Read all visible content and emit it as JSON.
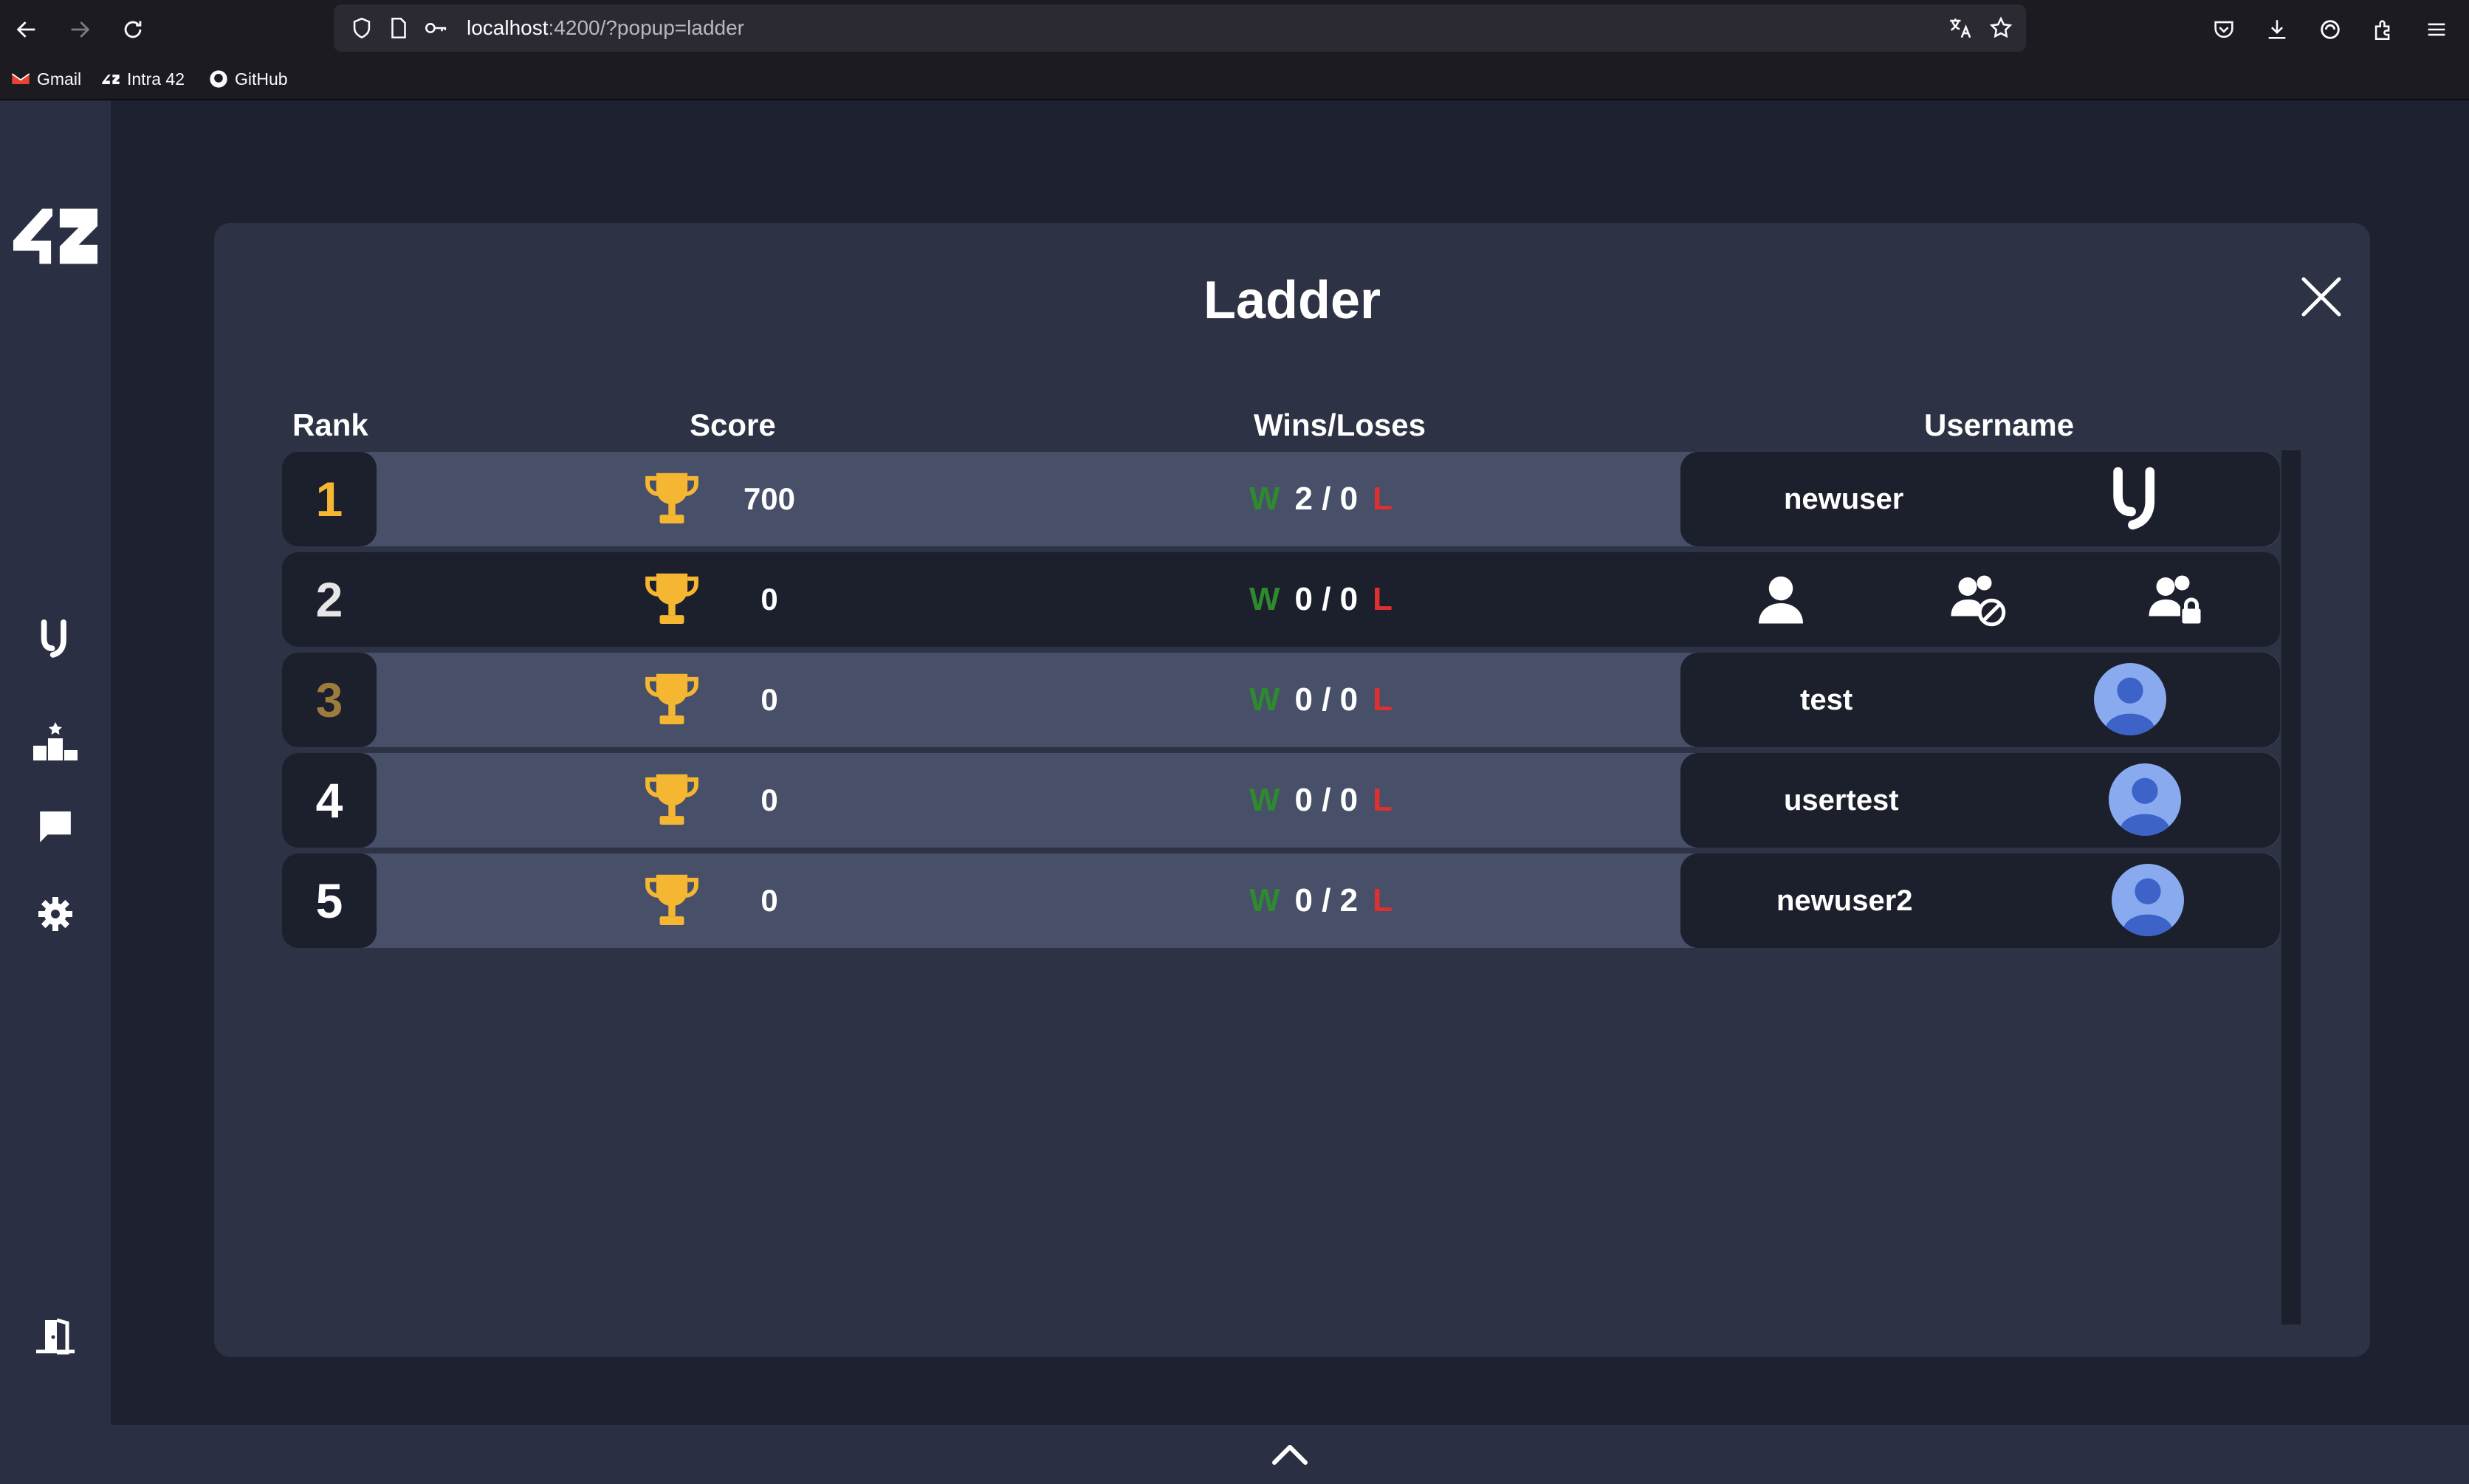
{
  "browser": {
    "url_host": "localhost",
    "url_rest": ":4200/?popup=ladder",
    "bookmarks": [
      {
        "label": "Gmail",
        "icon": "gmail-icon"
      },
      {
        "label": "Intra 42",
        "icon": "intra-42-icon"
      },
      {
        "label": "GitHub",
        "icon": "github-icon"
      }
    ]
  },
  "sidebar": {
    "logo": "42",
    "items": [
      {
        "name": "play",
        "icon": "u-logo-icon"
      },
      {
        "name": "ladder",
        "icon": "podium-icon"
      },
      {
        "name": "chat",
        "icon": "chat-icon"
      },
      {
        "name": "settings",
        "icon": "gear-icon"
      },
      {
        "name": "logout",
        "icon": "logout-door-icon"
      }
    ]
  },
  "ladder": {
    "title": "Ladder",
    "columns": {
      "rank": "Rank",
      "score": "Score",
      "wins_loses": "Wins/Loses",
      "username": "Username"
    },
    "win_letter": "W",
    "lose_letter": "L",
    "rows": [
      {
        "rank": "1",
        "score": "700",
        "wins_loses": "2 / 0",
        "username": "newuser",
        "avatar": "u-logo"
      },
      {
        "rank": "2",
        "score": "0",
        "wins_loses": "0 / 0",
        "username": "",
        "actions": [
          "view-profile-icon",
          "block-user-icon",
          "private-user-icon"
        ]
      },
      {
        "rank": "3",
        "score": "0",
        "wins_loses": "0 / 0",
        "username": "test",
        "avatar": "default-avatar"
      },
      {
        "rank": "4",
        "score": "0",
        "wins_loses": "0 / 0",
        "username": "usertest",
        "avatar": "default-avatar"
      },
      {
        "rank": "5",
        "score": "0",
        "wins_loses": "0 / 2",
        "username": "newuser2",
        "avatar": "default-avatar"
      }
    ]
  },
  "colors": {
    "app_bg": "#1e2130",
    "sidebar_bg": "#2a2f43",
    "modal_bg": "#2d3245",
    "row_highlight": "#474f69",
    "row_dark": "#1c1f2c",
    "gold": "#f5b731",
    "bronze": "#9c7c3e",
    "win_green": "#2f8a2f",
    "lose_red": "#e0302e",
    "avatar_blue": "#8aaaf0"
  }
}
